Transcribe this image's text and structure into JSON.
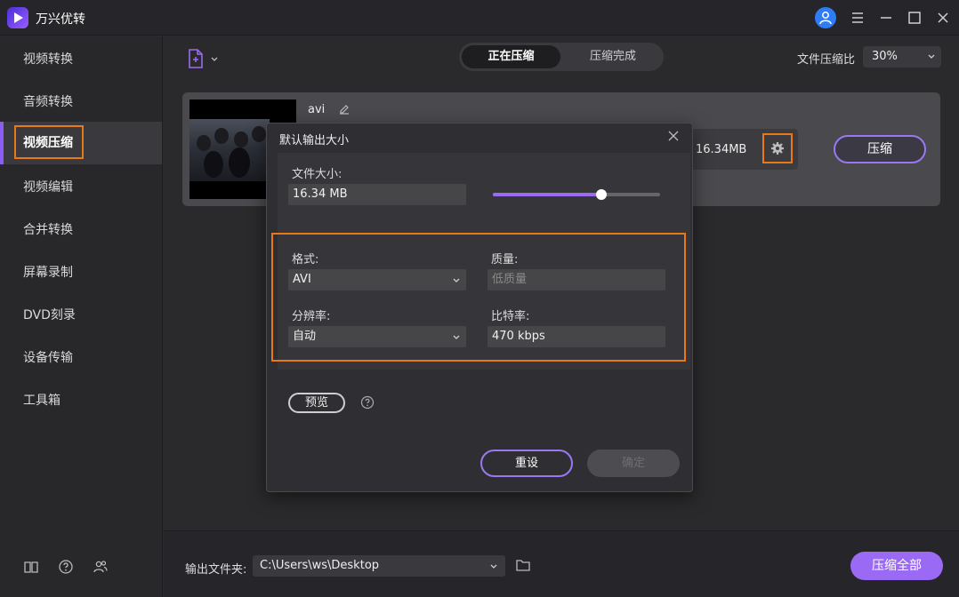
{
  "app": {
    "title": "万兴优转"
  },
  "sidebar": {
    "items": [
      {
        "label": "视频转换"
      },
      {
        "label": "音频转换"
      },
      {
        "label": "视频压缩",
        "active": true
      },
      {
        "label": "视频编辑"
      },
      {
        "label": "合并转换"
      },
      {
        "label": "屏幕录制"
      },
      {
        "label": "DVD刻录"
      },
      {
        "label": "设备传输"
      },
      {
        "label": "工具箱"
      }
    ],
    "footer_icons": [
      "book-icon",
      "help-icon",
      "users-icon"
    ]
  },
  "toolbar": {
    "add_file_icon": "add-file-icon",
    "tabs": [
      {
        "label": "正在压缩",
        "active": true
      },
      {
        "label": "压缩完成",
        "active": false
      }
    ],
    "ratio_label": "文件压缩比",
    "ratio_value": "30%"
  },
  "file_card": {
    "format": "avi",
    "size": "16.34MB",
    "compress_label": "压缩"
  },
  "dialog": {
    "title": "默认输出大小",
    "file_size_label": "文件大小:",
    "file_size_value": "16.34 MB",
    "slider_fraction": 0.65,
    "format_label": "格式:",
    "format_value": "AVI",
    "quality_label": "质量:",
    "quality_value": "低质量",
    "resolution_label": "分辨率:",
    "resolution_value": "自动",
    "bitrate_label": "比特率:",
    "bitrate_value": "470 kbps",
    "preview_label": "预览",
    "reset_label": "重设",
    "confirm_label": "确定"
  },
  "bottom": {
    "output_label": "输出文件夹:",
    "output_path": "C:\\Users\\ws\\Desktop",
    "compress_all_label": "压缩全部"
  },
  "colors": {
    "accent": "#9a6af5",
    "highlight": "#e77a16",
    "user_badge": "#2e7cf6"
  }
}
